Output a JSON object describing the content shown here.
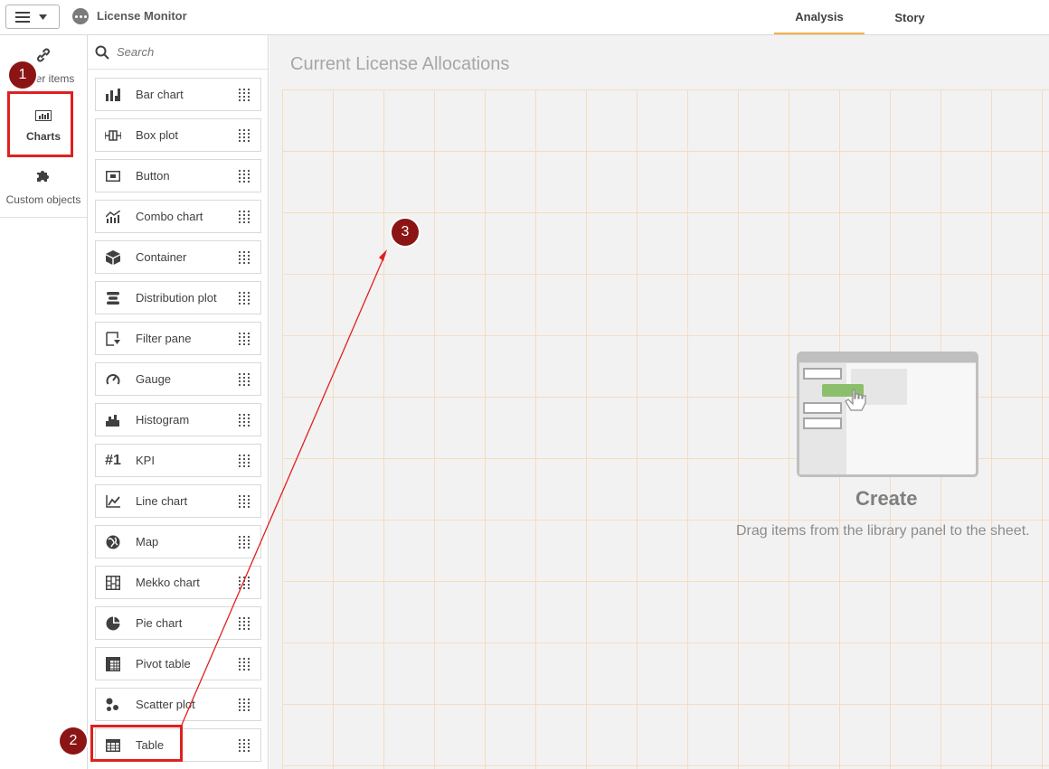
{
  "app": {
    "title": "License Monitor"
  },
  "tabs": [
    {
      "label": "Analysis",
      "active": true
    },
    {
      "label": "Story",
      "active": false
    }
  ],
  "leftnav": {
    "items": [
      {
        "label": "Master items",
        "icon": "link-icon"
      },
      {
        "label": "Charts",
        "icon": "chart-icon",
        "active": true
      },
      {
        "label": "Custom objects",
        "icon": "puzzle-icon"
      }
    ]
  },
  "library": {
    "search_placeholder": "Search",
    "items": [
      {
        "label": "Bar chart",
        "icon": "bar-chart-icon"
      },
      {
        "label": "Box plot",
        "icon": "box-plot-icon"
      },
      {
        "label": "Button",
        "icon": "button-icon"
      },
      {
        "label": "Combo chart",
        "icon": "combo-chart-icon"
      },
      {
        "label": "Container",
        "icon": "container-icon"
      },
      {
        "label": "Distribution plot",
        "icon": "distribution-plot-icon"
      },
      {
        "label": "Filter pane",
        "icon": "filter-pane-icon"
      },
      {
        "label": "Gauge",
        "icon": "gauge-icon"
      },
      {
        "label": "Histogram",
        "icon": "histogram-icon"
      },
      {
        "label": "KPI",
        "icon": "kpi-icon",
        "glyph": "#1"
      },
      {
        "label": "Line chart",
        "icon": "line-chart-icon"
      },
      {
        "label": "Map",
        "icon": "map-icon"
      },
      {
        "label": "Mekko chart",
        "icon": "mekko-chart-icon"
      },
      {
        "label": "Pie chart",
        "icon": "pie-chart-icon"
      },
      {
        "label": "Pivot table",
        "icon": "pivot-table-icon"
      },
      {
        "label": "Scatter plot",
        "icon": "scatter-plot-icon"
      },
      {
        "label": "Table",
        "icon": "table-icon"
      }
    ]
  },
  "sheet": {
    "title": "Current License Allocations",
    "empty_title": "Create",
    "empty_text": "Drag items from the library panel to the sheet."
  },
  "annotations": {
    "markers": [
      "1",
      "2",
      "3"
    ],
    "color": "#e02020"
  }
}
